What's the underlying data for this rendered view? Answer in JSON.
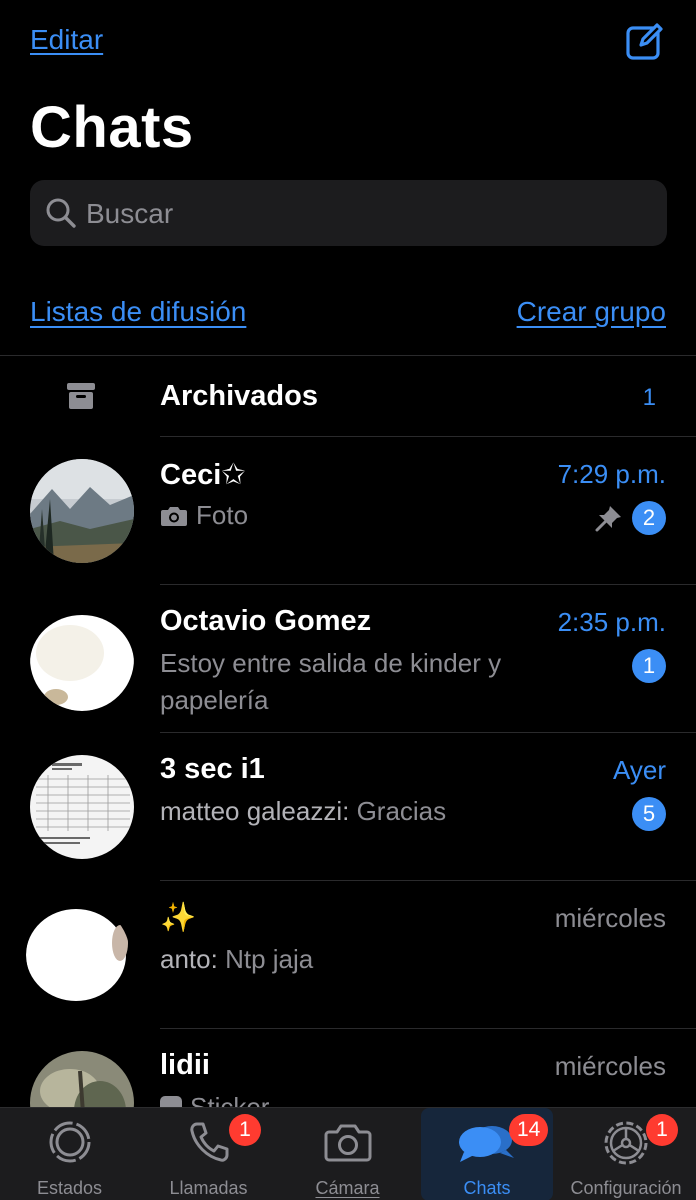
{
  "header": {
    "edit_label": "Editar",
    "title": "Chats"
  },
  "search": {
    "placeholder": "Buscar"
  },
  "links": {
    "broadcast": "Listas de difusión",
    "new_group": "Crear grupo"
  },
  "archived": {
    "label": "Archivados",
    "count": "1"
  },
  "chats": [
    {
      "name": "Ceci✩",
      "time": "7:29 p.m.",
      "preview": "Foto",
      "unread": "2",
      "pinned": true
    },
    {
      "name": "Octavio Gomez",
      "time": "2:35 p.m.",
      "preview": "Estoy entre salida de kinder y papelería",
      "unread": "1"
    },
    {
      "name": "3 sec i1",
      "time": "Ayer",
      "sender": "matteo galeazzi:",
      "preview": "Gracias",
      "unread": "5"
    },
    {
      "name": "✨",
      "time": "miércoles",
      "sender": "anto:",
      "preview": "Ntp jaja"
    },
    {
      "name": "lidii",
      "time": "miércoles",
      "preview": "Sticker"
    }
  ],
  "tabs": [
    {
      "label": "Estados"
    },
    {
      "label": "Llamadas",
      "badge": "1"
    },
    {
      "label": "Cámara"
    },
    {
      "label": "Chats",
      "badge": "14"
    },
    {
      "label": "Configuración",
      "badge": "1"
    }
  ],
  "colors": {
    "accent": "#3b8ef5",
    "badge_red": "#ff3b30",
    "background": "#000000",
    "secondary_text": "#8d8d93"
  }
}
